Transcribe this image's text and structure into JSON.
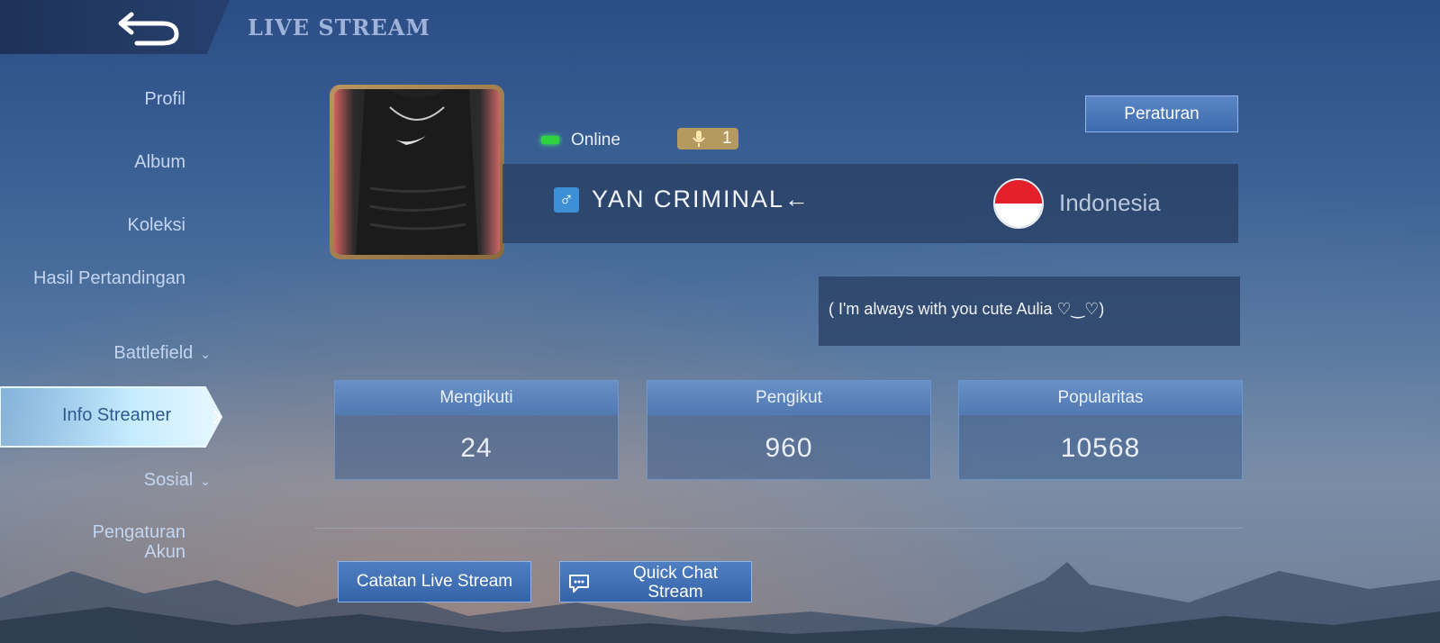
{
  "header": {
    "title": "LIVE STREAM",
    "back_icon": "back-arrow-icon"
  },
  "sidebar": {
    "items": [
      {
        "label": "Profil"
      },
      {
        "label": "Album"
      },
      {
        "label": "Koleksi"
      },
      {
        "label": "Hasil Pertandingan"
      },
      {
        "label": "Battlefield",
        "has_chevron": true
      },
      {
        "label": "Info Streamer",
        "active": true
      },
      {
        "label": "Sosial",
        "has_chevron": true
      },
      {
        "label": "Pengaturan Akun"
      }
    ]
  },
  "profile": {
    "status": "Online",
    "status_color": "#2fd23f",
    "mic_count": "1",
    "rules_button": "Peraturan",
    "gender_symbol": "♂",
    "name": "YAN CRIMINAL←",
    "country": "Indonesia",
    "bio": "( I'm always with you cute Aulia  ♡‿♡)"
  },
  "stats": [
    {
      "label": "Mengikuti",
      "value": "24"
    },
    {
      "label": "Pengikut",
      "value": "960"
    },
    {
      "label": "Popularitas",
      "value": "10568"
    }
  ],
  "actions": {
    "record_button": "Catatan Live Stream",
    "quick_chat_line1": "Quick Chat",
    "quick_chat_line2": "Stream"
  }
}
